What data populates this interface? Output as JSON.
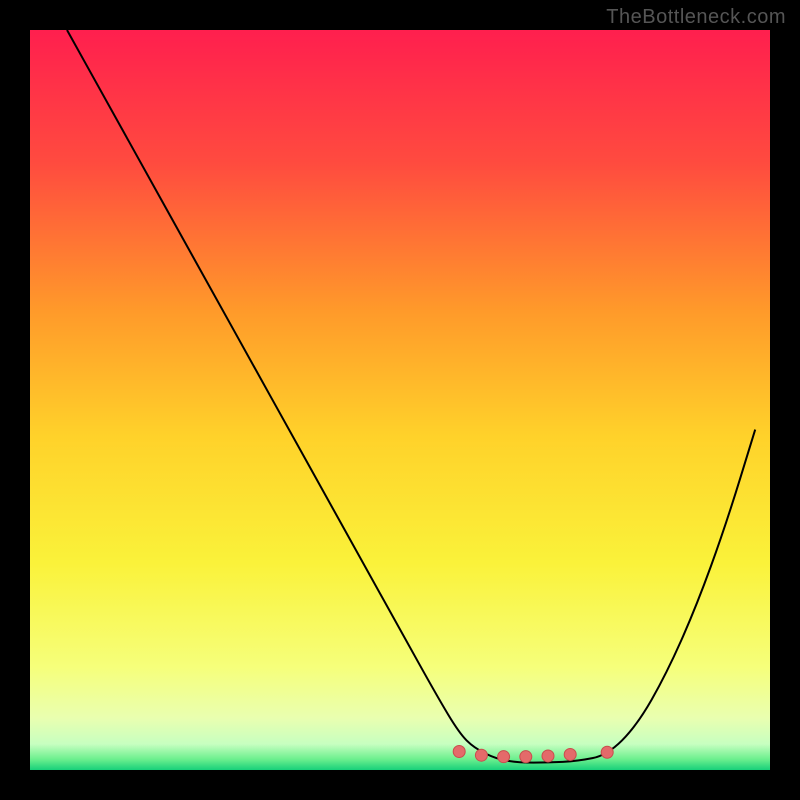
{
  "attribution": "TheBottleneck.com",
  "colors": {
    "curve": "#000000",
    "marker_fill": "#e46a6a",
    "marker_stroke": "#c94d4d",
    "bg_black": "#000000"
  },
  "chart_data": {
    "type": "line",
    "title": "",
    "xlabel": "",
    "ylabel": "",
    "xlim": [
      0,
      100
    ],
    "ylim": [
      0,
      100
    ],
    "grid": false,
    "legend": false,
    "background_gradient": {
      "stops": [
        {
          "t": 0.0,
          "color": "#ff1f4e"
        },
        {
          "t": 0.18,
          "color": "#ff4b3f"
        },
        {
          "t": 0.38,
          "color": "#ff9a2a"
        },
        {
          "t": 0.55,
          "color": "#ffd22a"
        },
        {
          "t": 0.72,
          "color": "#faf23a"
        },
        {
          "t": 0.86,
          "color": "#f6ff7a"
        },
        {
          "t": 0.93,
          "color": "#e9ffb0"
        },
        {
          "t": 0.965,
          "color": "#c7ffc0"
        },
        {
          "t": 0.985,
          "color": "#6ef08f"
        },
        {
          "t": 1.0,
          "color": "#17d07a"
        }
      ]
    },
    "series": [
      {
        "name": "bottleneck-curve",
        "x": [
          5,
          10,
          15,
          20,
          25,
          30,
          35,
          40,
          45,
          50,
          55,
          58,
          60,
          63,
          66,
          70,
          74,
          78,
          82,
          86,
          90,
          94,
          98
        ],
        "y": [
          100,
          91,
          82,
          73,
          64,
          55,
          46,
          37,
          28,
          19,
          10,
          5,
          3,
          1.5,
          1,
          1,
          1.2,
          2,
          6,
          13,
          22,
          33,
          46
        ]
      }
    ],
    "markers": {
      "name": "optimal-range",
      "points": [
        {
          "x": 58,
          "y": 2.5
        },
        {
          "x": 61,
          "y": 2.0
        },
        {
          "x": 64,
          "y": 1.8
        },
        {
          "x": 67,
          "y": 1.8
        },
        {
          "x": 70,
          "y": 1.9
        },
        {
          "x": 73,
          "y": 2.1
        },
        {
          "x": 78,
          "y": 2.4
        }
      ],
      "radius": 6
    }
  }
}
